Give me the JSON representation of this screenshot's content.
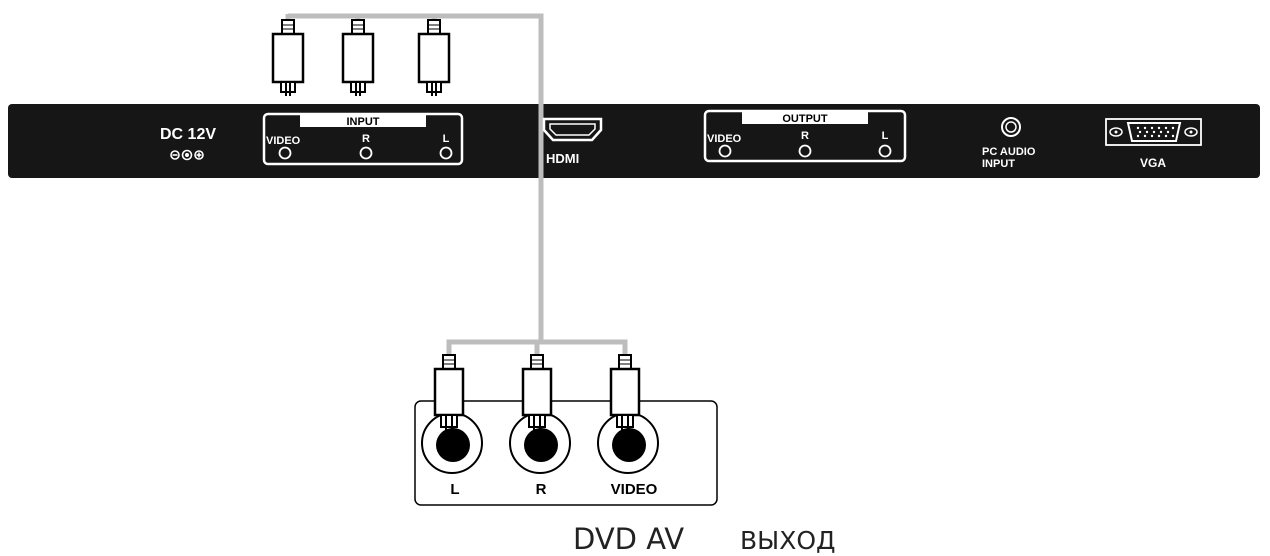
{
  "panel": {
    "dc_label": "DC 12V",
    "input_group": {
      "title": "INPUT",
      "video": "VIDEO",
      "r": "R",
      "l": "L"
    },
    "hdmi_label": "HDMI",
    "output_group": {
      "title": "OUTPUT",
      "video": "VIDEO",
      "r": "R",
      "l": "L"
    },
    "pc_audio_label_1": "PC AUDIO",
    "pc_audio_label_2": "INPUT",
    "vga_label": "VGA"
  },
  "dvd": {
    "jack_l": "L",
    "jack_r": "R",
    "jack_video": "VIDEO",
    "caption_1": "DVD AV",
    "caption_2": "ВЫХОД"
  },
  "colors": {
    "panel": "#161616",
    "cable": "#bdbdbd",
    "white": "#ffffff"
  }
}
